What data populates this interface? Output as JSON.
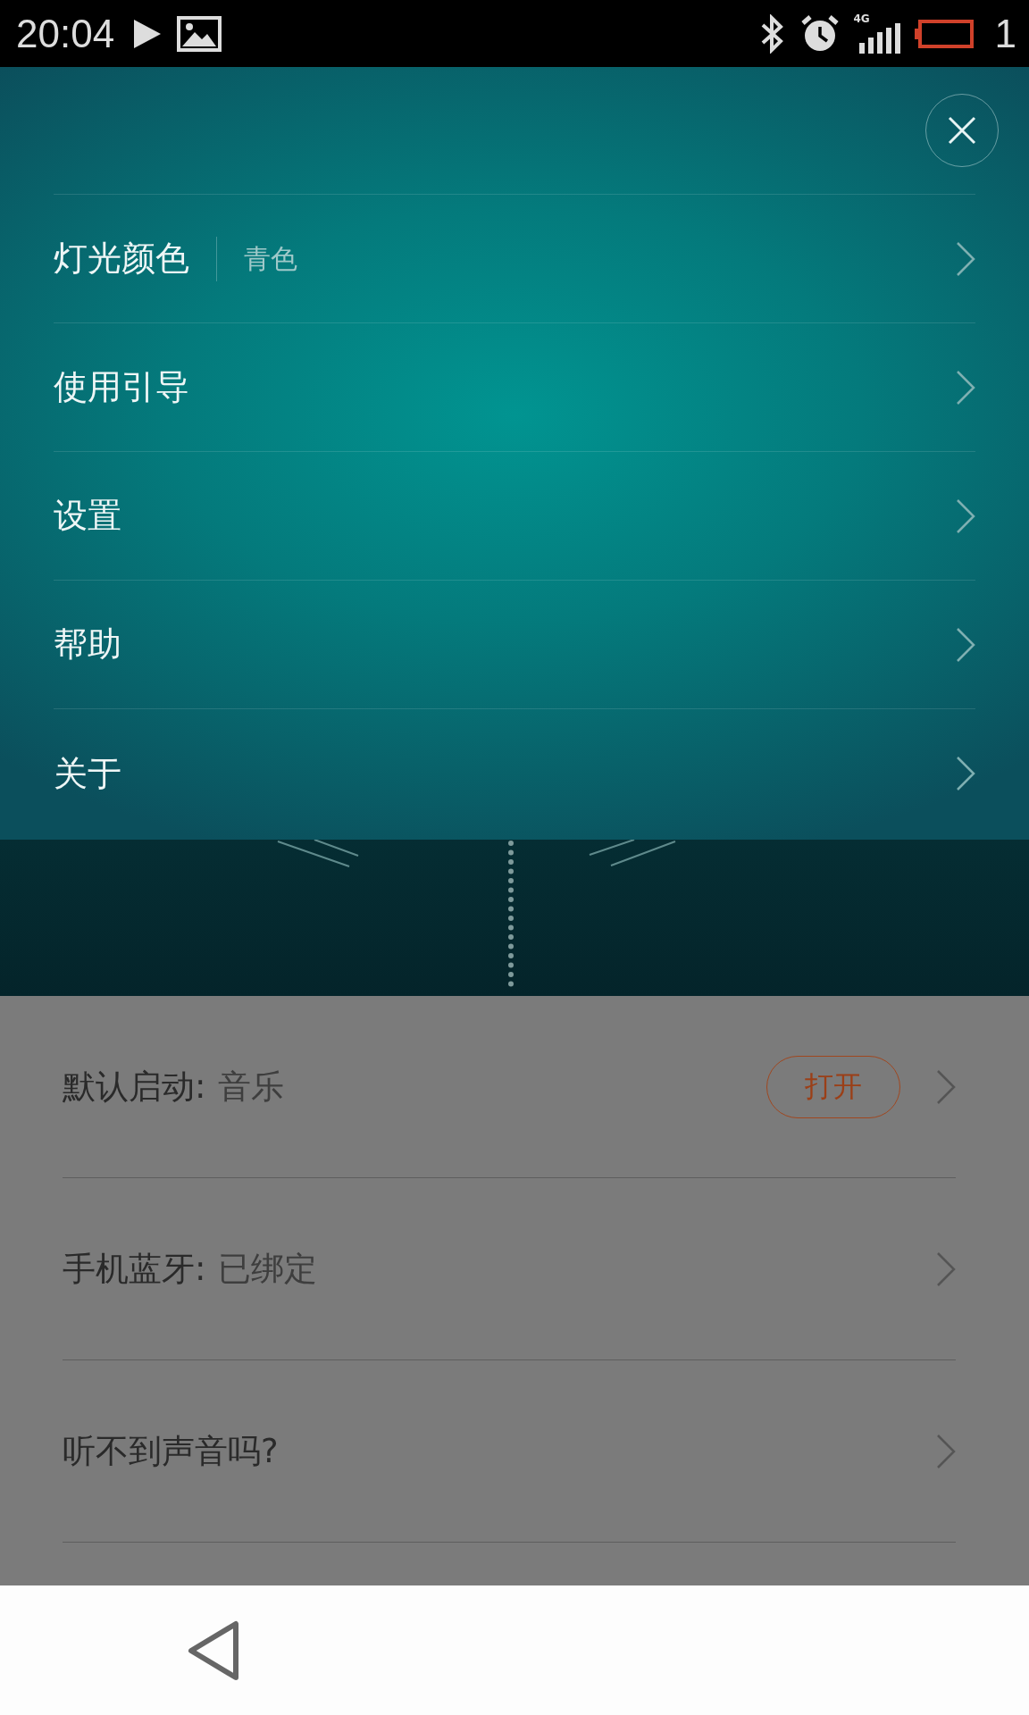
{
  "status_bar": {
    "time": "20:04",
    "network": "4G",
    "battery_text": "1"
  },
  "menu": {
    "items": [
      {
        "label": "灯光颜色",
        "value": "青色"
      },
      {
        "label": "使用引导"
      },
      {
        "label": "设置"
      },
      {
        "label": "帮助"
      },
      {
        "label": "关于"
      }
    ]
  },
  "settings_list": [
    {
      "label": "默认启动:",
      "value": "音乐",
      "button": "打开"
    },
    {
      "label": "手机蓝牙:",
      "value": "已绑定"
    },
    {
      "label": "听不到声音吗?"
    }
  ]
}
